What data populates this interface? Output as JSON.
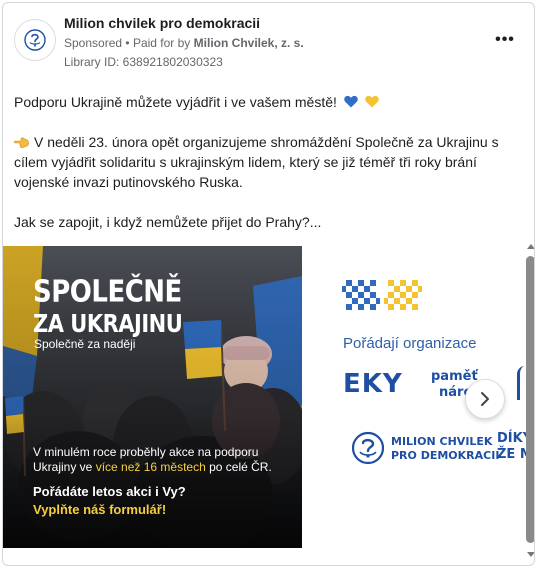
{
  "post": {
    "page_name": "Milion chvilek pro demokracii",
    "sponsored_label": "Sponsored",
    "paid_for_prefix": "Paid for by",
    "payer": "Milion Chvilek, z. s.",
    "library_id": "Library ID: 638921802030323",
    "more_label": "•••",
    "paragraphs": [
      "Podporu Ukrajině můžete vyjádřit i ve vašem městě!",
      "V neděli 23. února opět organizujeme shromáždění Společně za Ukrajinu s cílem vyjádřit solidaritu s ukrajinským lidem, který se již téměř tři roky brání vojenské invazi putinovského Ruska.",
      "Jak se zapojit, i když nemůžete přijet do Prahy?..."
    ],
    "icons": {
      "avatar": "milion-chvilek-logo-icon",
      "hearts": [
        "blue-heart-icon",
        "yellow-heart-icon"
      ],
      "hand": "backhand-index-pointing-left-icon",
      "next": "chevron-right-icon"
    }
  },
  "slide1": {
    "headline_1": "SPOLEČNĚ",
    "headline_2": "ZA UKRAJINU",
    "subline": "Společně za naději",
    "info_before": "V minulém roce proběhly akce na podporu Ukrajiny ve ",
    "info_highlight": "více než 16 městech",
    "info_after": " po celé ČR.",
    "cta_1": "Pořádáte letos akci i Vy?",
    "cta_2": "Vyplňte náš formulář!"
  },
  "slide2": {
    "organizers_title": "Pořádají organizace",
    "logo_eky": "EKY",
    "logo_pamet_1": "paměť",
    "logo_pamet_2": "národ",
    "logo_milion_1": "MILION CHVILEK",
    "logo_milion_2": "PRO DEMOKRACII",
    "logo_diky_1": "DÍKY",
    "logo_diky_2": "ŽE MŮ"
  },
  "colors": {
    "accent_blue": "#2f5fa8",
    "accent_yellow": "#f7cf3e",
    "ukraine_blue": "#2f6fc7",
    "ukraine_yellow": "#f4c430"
  }
}
